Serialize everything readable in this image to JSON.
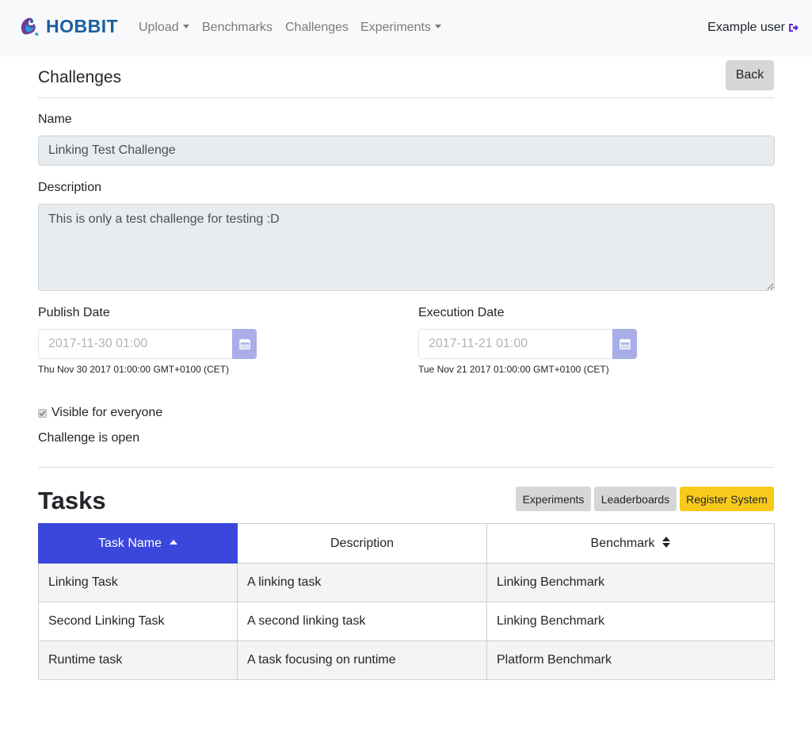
{
  "navbar": {
    "brand": "HOBBIT",
    "items": [
      {
        "label": "Upload",
        "dropdown": true
      },
      {
        "label": "Benchmarks",
        "dropdown": false
      },
      {
        "label": "Challenges",
        "dropdown": false
      },
      {
        "label": "Experiments",
        "dropdown": true
      }
    ],
    "user": "Example user",
    "user_icon": "sign-out-icon"
  },
  "page": {
    "title": "Challenges",
    "back_label": "Back"
  },
  "form": {
    "name_label": "Name",
    "name_value": "Linking Test Challenge",
    "description_label": "Description",
    "description_value": "This is only a test challenge for testing :D",
    "publish_date_label": "Publish Date",
    "publish_date_value": "2017-11-30 01:00",
    "publish_date_note": "Thu Nov 30 2017 01:00:00 GMT+0100 (CET)",
    "execution_date_label": "Execution Date",
    "execution_date_value": "2017-11-21 01:00",
    "execution_date_note": "Tue Nov 21 2017 01:00:00 GMT+0100 (CET)",
    "calendar_icon": "calendar-icon",
    "visible_label": "Visible for everyone",
    "visible_checked": true,
    "status_text": "Challenge is open"
  },
  "tasks": {
    "title": "Tasks",
    "buttons": {
      "experiments": "Experiments",
      "leaderboards": "Leaderboards",
      "register": "Register System"
    },
    "columns": [
      "Task Name",
      "Description",
      "Benchmark"
    ],
    "sort": {
      "column": "Task Name",
      "direction": "ascending"
    },
    "rows": [
      {
        "name": "Linking Task",
        "description": "A linking task",
        "benchmark": "Linking Benchmark"
      },
      {
        "name": "Second Linking Task",
        "description": "A second linking task",
        "benchmark": "Linking Benchmark"
      },
      {
        "name": "Runtime task",
        "description": "A task focusing on runtime",
        "benchmark": "Platform Benchmark"
      }
    ]
  },
  "colors": {
    "brand": "#1a5f9e",
    "active_header": "#3b47dc",
    "register_button": "#f9c91b",
    "calendar_button": "#a9aee8"
  }
}
